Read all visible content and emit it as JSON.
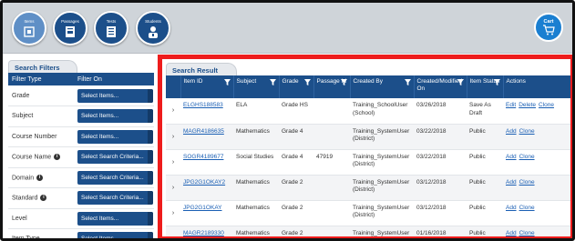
{
  "nav": {
    "buttons": [
      {
        "label": "Items",
        "icon": "items-icon"
      },
      {
        "label": "Passages",
        "icon": "passages-icon"
      },
      {
        "label": "Tests",
        "icon": "tests-icon"
      },
      {
        "label": "Students",
        "icon": "students-icon"
      }
    ],
    "cart_label": "Cart"
  },
  "filters": {
    "tab_label": "Search Filters",
    "col_type": "Filter Type",
    "col_on": "Filter On",
    "rows": [
      {
        "label": "Grade",
        "value": "Select Items...",
        "info": false
      },
      {
        "label": "Subject",
        "value": "Select Items...",
        "info": false
      },
      {
        "label": "Course Number",
        "value": "Select Items...",
        "info": false
      },
      {
        "label": "Course Name",
        "value": "Select Search Criteria...",
        "info": true
      },
      {
        "label": "Domain",
        "value": "Select Search Criteria...",
        "info": true
      },
      {
        "label": "Standard",
        "value": "Select Search Criteria...",
        "info": true
      },
      {
        "label": "Level",
        "value": "Select Items...",
        "info": false
      },
      {
        "label": "Item Type",
        "value": "Select Items...",
        "info": false
      }
    ]
  },
  "results": {
    "tab_label": "Search Result",
    "columns": [
      "Item ID",
      "Subject",
      "Grade",
      "Passage Id",
      "Created By",
      "Created/Modified On",
      "Item Status",
      "Actions"
    ],
    "rows": [
      {
        "id": "ELGHS188583",
        "subject": "ELA",
        "grade": "Grade HS",
        "passage": "",
        "created_by": "Training_SchoolUser (School)",
        "date": "03/26/2018",
        "status": "Save As Draft",
        "actions": [
          "Edit",
          "Delete",
          "Clone"
        ]
      },
      {
        "id": "MAGR4186635",
        "subject": "Mathematics",
        "grade": "Grade 4",
        "passage": "",
        "created_by": "Training_SystemUser (District)",
        "date": "03/22/2018",
        "status": "Public",
        "actions": [
          "Add",
          "Clone"
        ]
      },
      {
        "id": "SOGR4189677",
        "subject": "Social Studies",
        "grade": "Grade 4",
        "passage": "47919",
        "created_by": "Training_SystemUser (District)",
        "date": "03/22/2018",
        "status": "Public",
        "actions": [
          "Add",
          "Clone"
        ]
      },
      {
        "id": "JPG2G1OKAY2",
        "subject": "Mathematics",
        "grade": "Grade 2",
        "passage": "",
        "created_by": "Training_SystemUser (District)",
        "date": "03/12/2018",
        "status": "Public",
        "actions": [
          "Add",
          "Clone"
        ]
      },
      {
        "id": "JPG2G1OKAY",
        "subject": "Mathematics",
        "grade": "Grade 2",
        "passage": "",
        "created_by": "Training_SystemUser (District)",
        "date": "03/12/2018",
        "status": "Public",
        "actions": [
          "Add",
          "Clone"
        ]
      },
      {
        "id": "MAGR2189330",
        "subject": "Mathematics",
        "grade": "Grade 2",
        "passage": "",
        "created_by": "Training_SystemUser (District)",
        "date": "01/16/2018",
        "status": "Public",
        "actions": [
          "Add",
          "Clone"
        ]
      }
    ]
  },
  "colors": {
    "primary": "#1c4f8a",
    "highlight": "#ee1c1c",
    "link": "#1a5fb4"
  }
}
